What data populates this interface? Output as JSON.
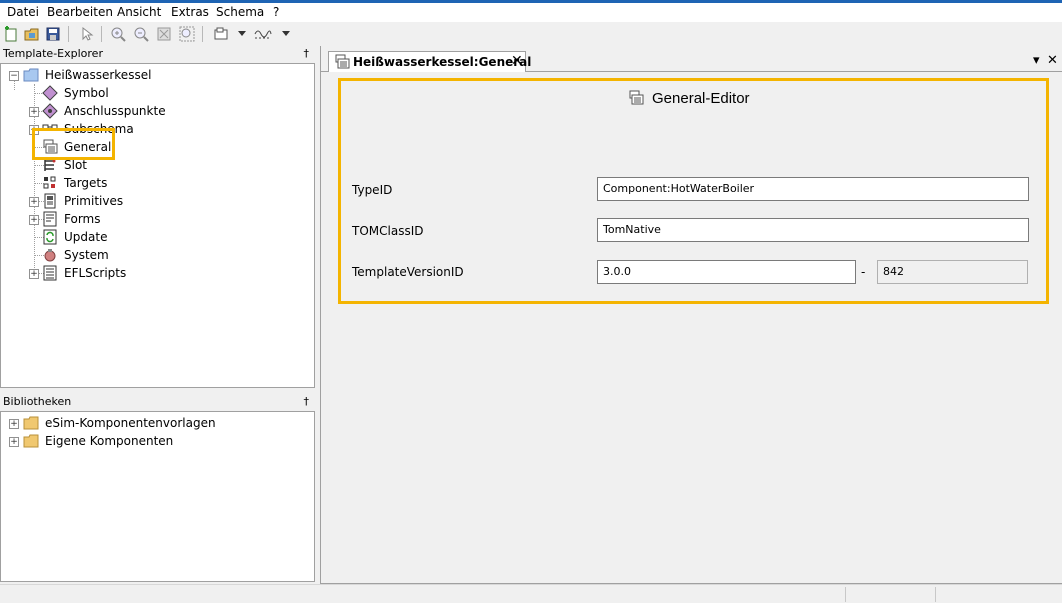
{
  "menu": [
    "Datei",
    "Bearbeiten",
    "Ansicht",
    "Extras",
    "Schema",
    "?"
  ],
  "toolbar": {
    "icons": [
      "new-icon",
      "open-icon",
      "save-icon",
      "pointer-icon",
      "zoom-in-icon",
      "zoom-out-icon",
      "zoom-fit-icon",
      "zoom-area-icon",
      "layout-icon",
      "wave-icon"
    ]
  },
  "template_explorer": {
    "title": "Template-Explorer",
    "pin": "†",
    "root": "Heißwasserkessel",
    "items": [
      "Symbol",
      "Anschlusspunkte",
      "Subschema",
      "General",
      "Slot",
      "Targets",
      "Primitives",
      "Forms",
      "Update",
      "System",
      "EFLScripts"
    ]
  },
  "libraries": {
    "title": "Bibliotheken",
    "pin": "†",
    "items": [
      "eSim-Komponentenvorlagen",
      "Eigene Komponenten"
    ]
  },
  "tab": {
    "label": "Heißwasserkessel:General",
    "close": "✕"
  },
  "window_controls": {
    "dropdown": "▾",
    "close": "✕"
  },
  "editor": {
    "title": "General-Editor",
    "fields": [
      {
        "label": "TypeID",
        "value": "Component:HotWaterBoiler"
      },
      {
        "label": "TOMClassID",
        "value": "TomNative"
      },
      {
        "label": "TemplateVersionID",
        "value": "3.0.0",
        "separator": "-",
        "build": "842"
      }
    ]
  },
  "colors": {
    "accent": "#1e64b4",
    "highlight": "#f4b400"
  }
}
